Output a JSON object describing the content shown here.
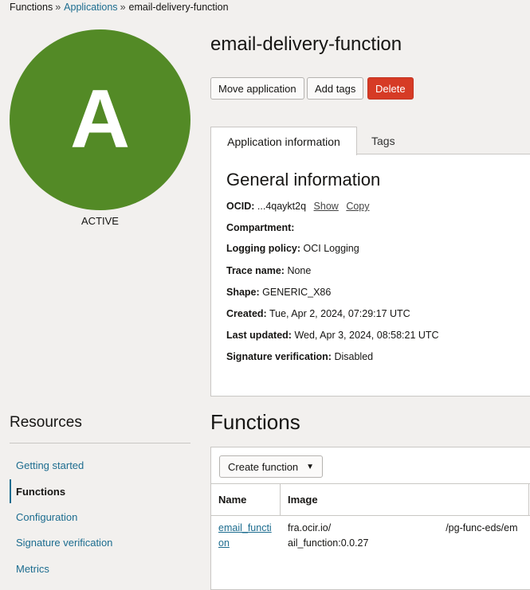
{
  "breadcrumb": {
    "root": "Functions",
    "parent": "Applications",
    "current": "email-delivery-function",
    "separator": "»"
  },
  "avatar": {
    "letter": "A",
    "status": "ACTIVE",
    "color": "#538a26"
  },
  "header": {
    "title": "email-delivery-function"
  },
  "actions": {
    "move": "Move application",
    "tags": "Add tags",
    "delete": "Delete"
  },
  "tabs": {
    "info": "Application information",
    "tags": "Tags"
  },
  "general": {
    "heading": "General information",
    "ocid_label": "OCID:",
    "ocid_value": "...4qaykt2q",
    "show": "Show",
    "copy": "Copy",
    "compartment_label": "Compartment:",
    "compartment_value": "",
    "logging_label": "Logging policy:",
    "logging_value": "OCI Logging",
    "trace_label": "Trace name:",
    "trace_value": "None",
    "shape_label": "Shape:",
    "shape_value": "GENERIC_X86",
    "created_label": "Created:",
    "created_value": "Tue, Apr 2, 2024, 07:29:17 UTC",
    "updated_label": "Last updated:",
    "updated_value": "Wed, Apr 3, 2024, 08:58:21 UTC",
    "sig_label": "Signature verification:",
    "sig_value": "Disabled"
  },
  "resources": {
    "title": "Resources",
    "items": [
      "Getting started",
      "Functions",
      "Configuration",
      "Signature verification",
      "Metrics"
    ],
    "active": "Functions"
  },
  "functions": {
    "title": "Functions",
    "create": "Create function",
    "columns": [
      "Name",
      "Image"
    ],
    "rows": [
      {
        "name_line1": "email_functi",
        "name_line2": "on",
        "image_line1a": "fra.ocir.io/",
        "image_line1b": "/pg-func-eds/em",
        "image_line2": "ail_function:0.0.27"
      }
    ]
  },
  "colors": {
    "accent": "#1c6c8f",
    "danger": "#d63b25",
    "background": "#f2f0ee"
  }
}
